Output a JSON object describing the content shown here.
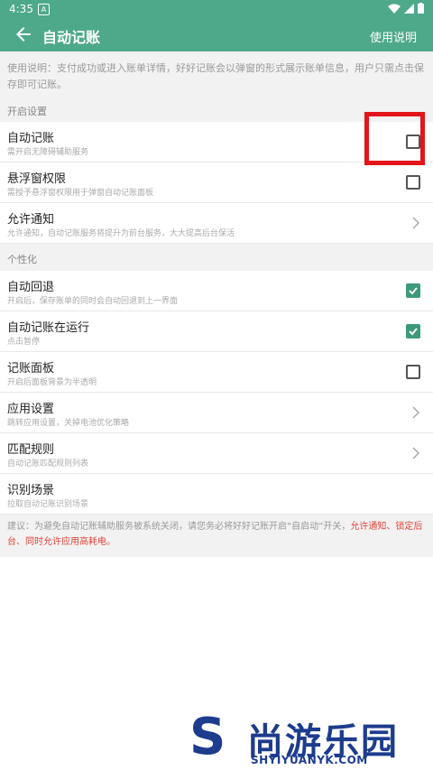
{
  "status_bar": {
    "time": "4:35",
    "app_badge": "A"
  },
  "app_bar": {
    "title": "自动记账",
    "help_label": "使用说明"
  },
  "description": "使用说明：支付成功或进入账单详情，好好记账会以弹窗的形式展示账单信息，用户只需点击保存即可记账。",
  "sections": {
    "startup": "开启设置",
    "personal": "个性化"
  },
  "rows": [
    {
      "label": "自动记账",
      "sub": "需开启无障碍辅助服务",
      "control": "checkbox",
      "checked": false
    },
    {
      "label": "悬浮窗权限",
      "sub": "需授予悬浮窗权限用于弹窗自动记账面板",
      "control": "checkbox",
      "checked": false
    },
    {
      "label": "允许通知",
      "sub": "允许通知，自动记账服务将提升为前台服务，大大提高后台保活",
      "control": "chevron"
    },
    {
      "label": "自动回退",
      "sub": "开启后，保存账单的同时会自动回退到上一界面",
      "control": "checkbox",
      "checked": true
    },
    {
      "label": "自动记账在运行",
      "sub": "点击暂停",
      "control": "checkbox",
      "checked": true
    },
    {
      "label": "记账面板",
      "sub": "开启后面板背景为半透明",
      "control": "checkbox",
      "checked": false
    },
    {
      "label": "应用设置",
      "sub": "跳转应用设置，关掉电池优化策略",
      "control": "chevron"
    },
    {
      "label": "匹配规则",
      "sub": "自动记账匹配规则列表",
      "control": "chevron"
    },
    {
      "label": "识别场景",
      "sub": "拉取自动记账识别场景",
      "control": "none"
    }
  ],
  "tip": {
    "normal": "建议：为避免自动记账辅助服务被系统关闭，请您务必将好好记账开启“自启动”开关，",
    "warning": "允许通知、锁定后台、同时允许应用高耗电。"
  },
  "watermark": {
    "brand": "尚游乐园",
    "url": "SHYIYUANYK.COM"
  },
  "colors": {
    "primary": "#4da98a",
    "checkbox_on": "#3c9a78",
    "highlight": "#e3151a",
    "warning": "#e0443a"
  }
}
